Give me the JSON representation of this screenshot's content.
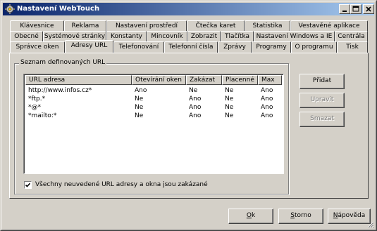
{
  "window": {
    "title": "Nastavení WebTouch",
    "icon": "gear-icon",
    "controls": [
      "minimize-icon",
      "maximize-icon",
      "close-icon"
    ]
  },
  "tabs": {
    "row1": [
      "Klávesnice",
      "Reklama",
      "Nastavení prostředí",
      "Čtečka karet",
      "Statistika",
      "Vestavěné aplikace"
    ],
    "row2": [
      "Obecné",
      "Systémové stránky",
      "Konstanty",
      "Mincovník",
      "Zobrazit",
      "Tlačítka",
      "Nastavení Windows a IE",
      "Centrála"
    ],
    "row3": [
      "Správce oken",
      "Adresy URL",
      "Telefonování",
      "Telefonní čísla",
      "Zprávy",
      "Programy",
      "O programu",
      "Tisk"
    ],
    "active": "Adresy URL"
  },
  "group": {
    "label": "Seznam definovaných URL"
  },
  "table": {
    "columns": [
      "URL adresa",
      "Otevírání oken",
      "Zakázat",
      "Placenné",
      "Max"
    ],
    "rows": [
      [
        "http://www.infos.cz*",
        "Ano",
        "Ne",
        "Ne",
        "Ano"
      ],
      [
        "*ftp.*",
        "Ne",
        "Ano",
        "Ne",
        "Ano"
      ],
      [
        "*@*",
        "Ne",
        "Ano",
        "Ne",
        "Ano"
      ],
      [
        "*mailto:*",
        "Ne",
        "Ano",
        "Ne",
        "Ano"
      ]
    ]
  },
  "side_buttons": {
    "add": "Přidat",
    "edit": "Upravit",
    "delete": "Smazat"
  },
  "checkbox": {
    "label": "Všechny neuvedené URL adresy a okna jsou zakázané",
    "checked": true
  },
  "footer_buttons": {
    "ok": "Ok",
    "cancel": "Storno",
    "help": "Nápověda"
  }
}
